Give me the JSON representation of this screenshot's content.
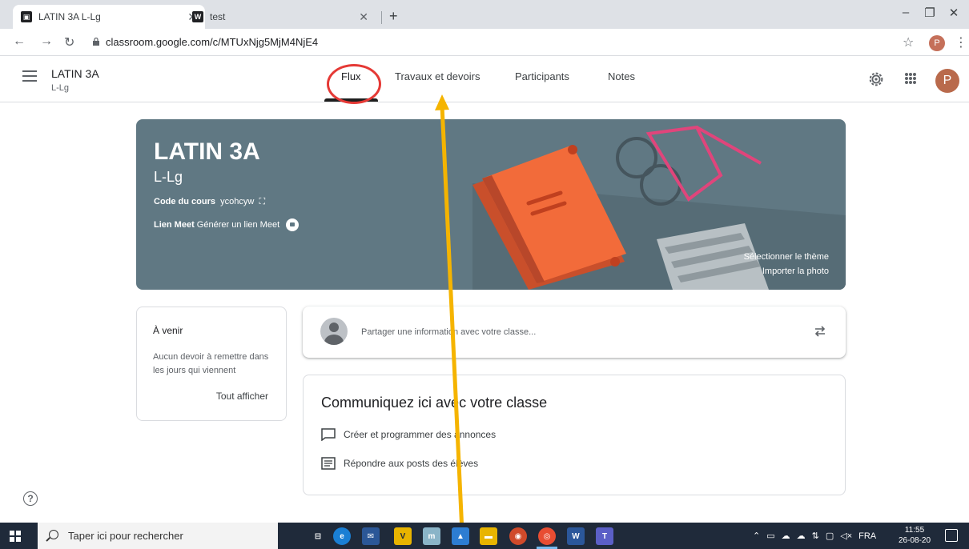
{
  "browser": {
    "tabs": [
      {
        "title": "LATIN 3A L-Lg",
        "favicon": "classroom-icon"
      },
      {
        "title": "test",
        "favicon": "wix-icon"
      }
    ],
    "url": "classroom.google.com/c/MTUxNjg5MjM4NjE4",
    "profile_initial": "P"
  },
  "header": {
    "class_name": "LATIN 3A",
    "section": "L-Lg",
    "tabs": [
      "Flux",
      "Travaux et devoirs",
      "Participants",
      "Notes"
    ],
    "active_tab": "Flux",
    "user_initial": "P"
  },
  "banner": {
    "title": "LATIN 3A",
    "section": "L-Lg",
    "code_label": "Code du cours",
    "code_value": "ycohcyw",
    "meet_label": "Lien Meet",
    "meet_action": "Générer un lien Meet",
    "select_theme": "Sélectionner le thème",
    "import_photo": "Importer la photo"
  },
  "upcoming": {
    "title": "À venir",
    "text": "Aucun devoir à remettre dans les jours qui viennent",
    "view_all": "Tout afficher"
  },
  "share": {
    "placeholder": "Partager une information avec votre classe..."
  },
  "communicate": {
    "title": "Communiquez ici avec votre classe",
    "items": [
      "Créer et programmer des annonces",
      "Répondre aux posts des élèves"
    ]
  },
  "taskbar": {
    "search_placeholder": "Taper ici pour rechercher",
    "language": "FRA",
    "time": "11:55",
    "date": "26-08-20"
  },
  "colors": {
    "banner_bg": "#607883",
    "book": "#f26b3a",
    "annotation_circle": "#e53935",
    "annotation_arrow": "#f5b400"
  }
}
